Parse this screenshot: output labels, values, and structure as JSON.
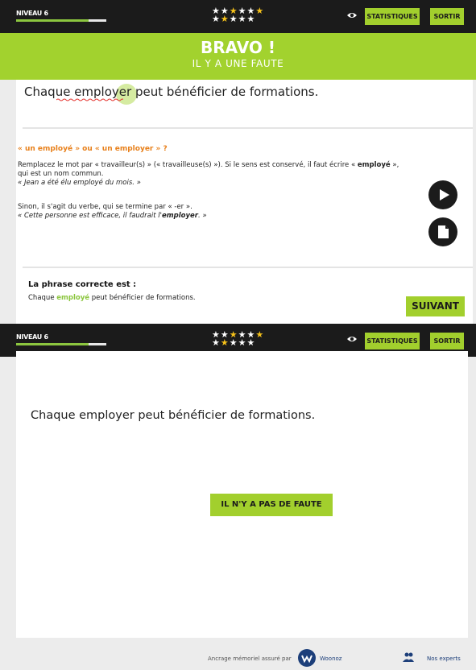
{
  "screen1": {
    "topbar": {
      "level_label": "NIVEAU 6",
      "progress": 0.8,
      "stars_row1": [
        "white",
        "white",
        "yellow",
        "white",
        "white",
        "yellow"
      ],
      "stars_row2": [
        "white",
        "yellow",
        "white",
        "white",
        "white"
      ],
      "stats_label": "STATISTIQUES",
      "exit_label": "SORTIR"
    },
    "result": {
      "title": "BRAVO !",
      "subtitle": "IL Y A UNE FAUTE"
    },
    "sentence": "Chaque employer peut bénéficier de formations.",
    "explanation": {
      "title": "« un employé » ou « un employer » ?",
      "p1_start": "Remplacez le mot par « travailleur(s) » (« travailleuse(s) »). Si le sens est conservé, il faut écrire « ",
      "p1_bold": "employé",
      "p1_end": " »,",
      "p1_line2": "qui est un nom commun.",
      "p1_example": "« Jean a été élu employé du mois. »",
      "p2": "Sinon, il s'agit du verbe, qui se termine par « -er ».",
      "p2_example_start": "« Cette personne est efficace, il faudrait l'",
      "p2_example_bold": "employer",
      "p2_example_end": ". »"
    },
    "correct_title": "La phrase correcte est :",
    "correct_before": "Chaque ",
    "correct_word": "employé",
    "correct_after": " peut bénéficier de formations.",
    "next_label": "SUIVANT"
  },
  "screen2": {
    "topbar": {
      "level_label": "NIVEAU 6",
      "progress": 0.8,
      "stats_label": "STATISTIQUES",
      "exit_label": "SORTIR"
    },
    "sentence": "Chaque employer peut bénéficier de formations.",
    "no_fault_label": "IL N'Y A PAS DE FAUTE"
  },
  "footer": {
    "credit": "Ancrage mémoriel assuré par",
    "brand": "Woonoz",
    "experts": "Nos experts"
  },
  "colors": {
    "accent": "#a2cf2d",
    "dark": "#1b1b1b",
    "orange": "#e8801b",
    "star_yellow": "#f6c21a"
  }
}
